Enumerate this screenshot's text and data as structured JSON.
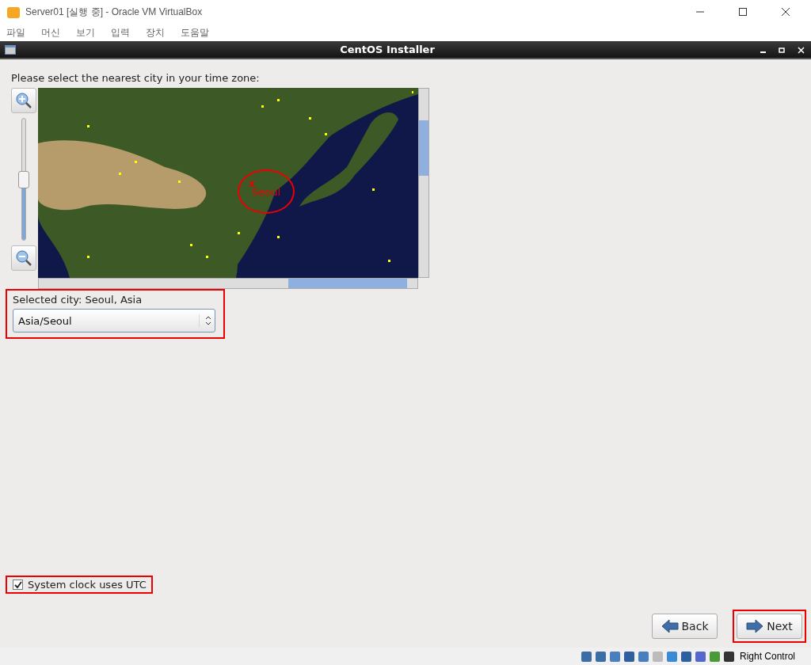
{
  "window": {
    "title": "Server01 [실행 중] - Oracle VM VirtualBox"
  },
  "menu": [
    "파일",
    "머신",
    "보기",
    "입력",
    "장치",
    "도움말"
  ],
  "installer": {
    "title": "CentOS Installer"
  },
  "prompt": "Please select the nearest city in your time zone:",
  "zoom": {
    "level": 0.5
  },
  "map": {
    "marker_label": "Seoul",
    "marker_symbol": "x"
  },
  "selected_city": {
    "label": "Selected city: Seoul, Asia",
    "value": "Asia/Seoul",
    "highlighted": true
  },
  "utc": {
    "label": "System clock uses UTC",
    "checked": true,
    "highlighted": true
  },
  "buttons": [
    {
      "label": "Back",
      "kind": "back",
      "highlighted": false
    },
    {
      "label": "Next",
      "kind": "next",
      "highlighted": true
    }
  ],
  "status_bar": {
    "host_key": "Right Control"
  }
}
